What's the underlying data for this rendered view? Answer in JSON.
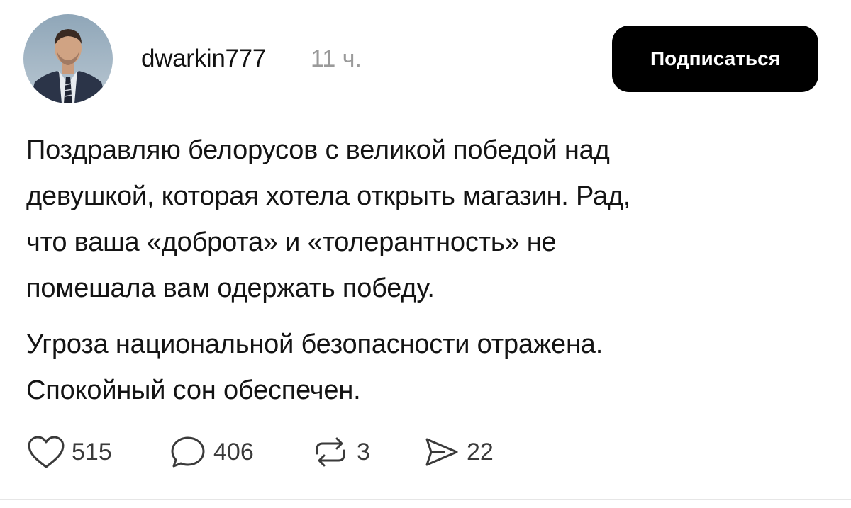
{
  "post": {
    "author": {
      "username": "dwarkin777",
      "time_ago": "11 ч."
    },
    "subscribe_label": "Подписаться",
    "text": {
      "paragraph1": [
        "Поздравляю белорусов с великой победой над",
        "девушкой, которая хотела открыть магазин. Рад,",
        "что ваша «доброта» и «толерантность» не",
        "помешала вам одержать победу."
      ],
      "paragraph2": [
        "Угроза национальной безопасности отражена.",
        "Спокойный сон обеспечен."
      ]
    },
    "actions": {
      "likes": "515",
      "comments": "406",
      "reposts": "3",
      "shares": "22"
    },
    "icons": {
      "like": "heart-icon",
      "comment": "comment-bubble-icon",
      "repost": "repost-icon",
      "share": "send-icon"
    },
    "colors": {
      "button_bg": "#000000",
      "button_text": "#ffffff",
      "timestamp": "#9a9a9a"
    }
  }
}
